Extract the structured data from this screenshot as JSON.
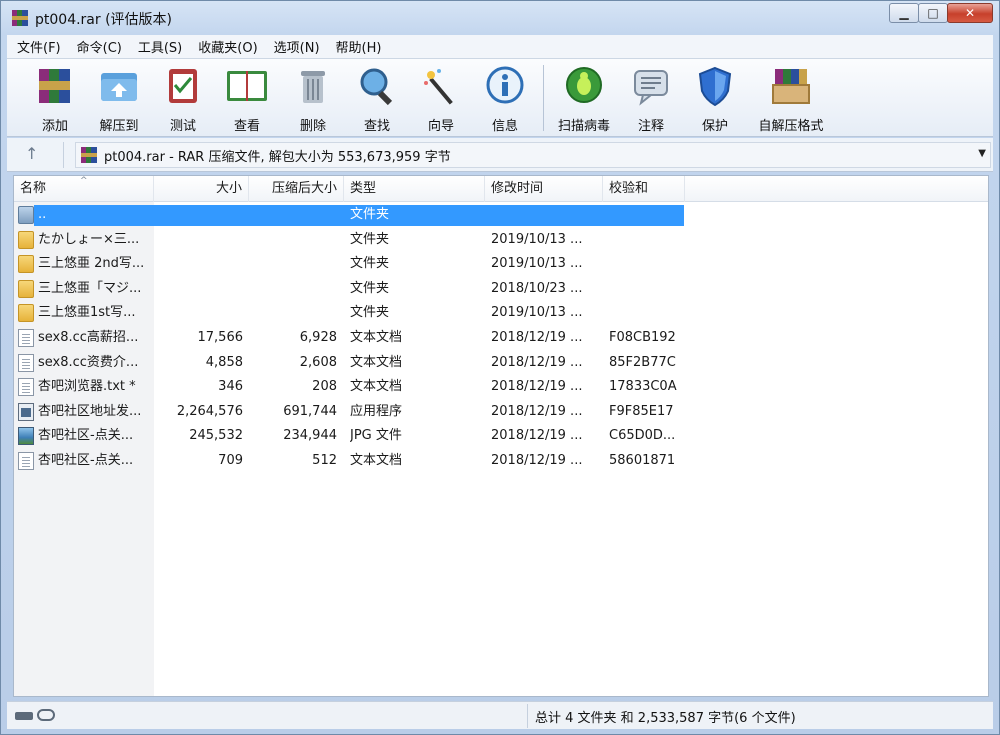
{
  "window": {
    "title": "pt004.rar (评估版本)",
    "controls": {
      "minimize": "▁",
      "maximize": "□",
      "close": "✕"
    }
  },
  "menu": [
    "文件(F)",
    "命令(C)",
    "工具(S)",
    "收藏夹(O)",
    "选项(N)",
    "帮助(H)"
  ],
  "toolbar": [
    {
      "label": "添加",
      "icon": "add-archive-icon"
    },
    {
      "label": "解压到",
      "icon": "extract-folder-icon"
    },
    {
      "label": "测试",
      "icon": "test-checklist-icon"
    },
    {
      "label": "查看",
      "icon": "view-book-icon"
    },
    {
      "label": "删除",
      "icon": "trash-can-icon"
    },
    {
      "label": "查找",
      "icon": "magnifier-icon"
    },
    {
      "label": "向导",
      "icon": "wizard-wand-icon"
    },
    {
      "label": "信息",
      "icon": "info-icon"
    },
    {
      "label": "扫描病毒",
      "icon": "virus-scan-icon"
    },
    {
      "label": "注释",
      "icon": "comment-icon"
    },
    {
      "label": "保护",
      "icon": "shield-icon"
    },
    {
      "label": "自解压格式",
      "icon": "sfx-box-icon"
    }
  ],
  "address": {
    "up": "↑",
    "path": "pt004.rar - RAR 压缩文件, 解包大小为 553,673,959 字节",
    "dropdown": "▼"
  },
  "columns": {
    "name": "名称",
    "size": "大小",
    "packed": "压缩后大小",
    "type": "类型",
    "modified": "修改时间",
    "crc": "校验和",
    "sort_indicator": "^"
  },
  "files": [
    {
      "name": "..",
      "size": "",
      "packed": "",
      "type": "文件夹",
      "modified": "",
      "crc": "",
      "icon": "folder-up-icon",
      "selected": true
    },
    {
      "name": "たかしょー×三...",
      "size": "",
      "packed": "",
      "type": "文件夹",
      "modified": "2019/10/13 ...",
      "crc": "",
      "icon": "folder-icon"
    },
    {
      "name": "三上悠亜 2nd写...",
      "size": "",
      "packed": "",
      "type": "文件夹",
      "modified": "2019/10/13 ...",
      "crc": "",
      "icon": "folder-icon"
    },
    {
      "name": "三上悠亜「マジ...",
      "size": "",
      "packed": "",
      "type": "文件夹",
      "modified": "2018/10/23 ...",
      "crc": "",
      "icon": "folder-icon"
    },
    {
      "name": "三上悠亜1st写...",
      "size": "",
      "packed": "",
      "type": "文件夹",
      "modified": "2019/10/13 ...",
      "crc": "",
      "icon": "folder-icon"
    },
    {
      "name": "sex8.cc高薪招...",
      "size": "17,566",
      "packed": "6,928",
      "type": "文本文档",
      "modified": "2018/12/19 ...",
      "crc": "F08CB192",
      "icon": "text-file-icon"
    },
    {
      "name": "sex8.cc资费介...",
      "size": "4,858",
      "packed": "2,608",
      "type": "文本文档",
      "modified": "2018/12/19 ...",
      "crc": "85F2B77C",
      "icon": "text-file-icon"
    },
    {
      "name": "杏吧浏览器.txt *",
      "size": "346",
      "packed": "208",
      "type": "文本文档",
      "modified": "2018/12/19 ...",
      "crc": "17833C0A",
      "icon": "text-file-icon"
    },
    {
      "name": "杏吧社区地址发...",
      "size": "2,264,576",
      "packed": "691,744",
      "type": "应用程序",
      "modified": "2018/12/19 ...",
      "crc": "F9F85E17",
      "icon": "executable-icon"
    },
    {
      "name": "杏吧社区-点关...",
      "size": "245,532",
      "packed": "234,944",
      "type": "JPG 文件",
      "modified": "2018/12/19 ...",
      "crc": "C65D0D...",
      "icon": "image-file-icon"
    },
    {
      "name": "杏吧社区-点关...",
      "size": "709",
      "packed": "512",
      "type": "文本文档",
      "modified": "2018/12/19 ...",
      "crc": "58601871",
      "icon": "text-file-icon"
    }
  ],
  "status": {
    "summary": "总计 4 文件夹 和 2,533,587 字节(6 个文件)"
  }
}
